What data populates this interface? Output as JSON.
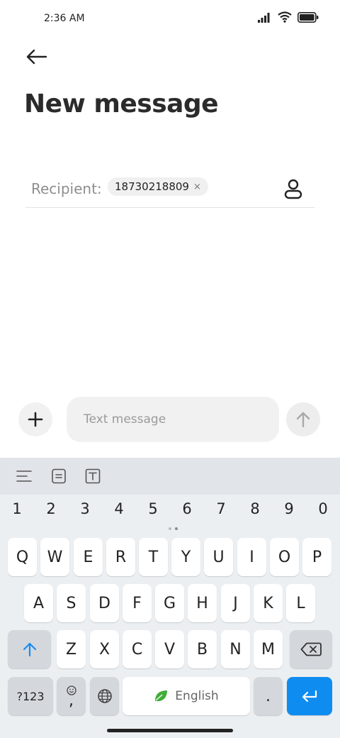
{
  "status": {
    "time": "2:36 AM",
    "icons": [
      "signal-icon",
      "wifi-icon",
      "battery-icon"
    ]
  },
  "header": {
    "back_icon": "arrow-left-icon",
    "title": "New message"
  },
  "recipient": {
    "label": "Recipient:",
    "chip_value": "18730218809",
    "chip_close": "×",
    "contact_icon": "person-icon"
  },
  "composer": {
    "attach_icon": "plus-icon",
    "placeholder": "Text message",
    "send_icon": "arrow-up-icon"
  },
  "keyboard": {
    "toolbar_icons": [
      "menu-lines-icon",
      "clipboard-icon",
      "text-box-icon"
    ],
    "numbers": [
      "1",
      "2",
      "3",
      "4",
      "5",
      "6",
      "7",
      "8",
      "9",
      "0"
    ],
    "row1": [
      "Q",
      "W",
      "E",
      "R",
      "T",
      "Y",
      "U",
      "I",
      "O",
      "P"
    ],
    "row2": [
      "A",
      "S",
      "D",
      "F",
      "G",
      "H",
      "J",
      "K",
      "L"
    ],
    "row3": [
      "Z",
      "X",
      "C",
      "V",
      "B",
      "N",
      "M"
    ],
    "symbols_label": "?123",
    "comma_label": ",",
    "space_label": "English",
    "period_label": ".",
    "colors": {
      "enter": "#0f8cf0",
      "leaf": "#3fae3a"
    }
  }
}
